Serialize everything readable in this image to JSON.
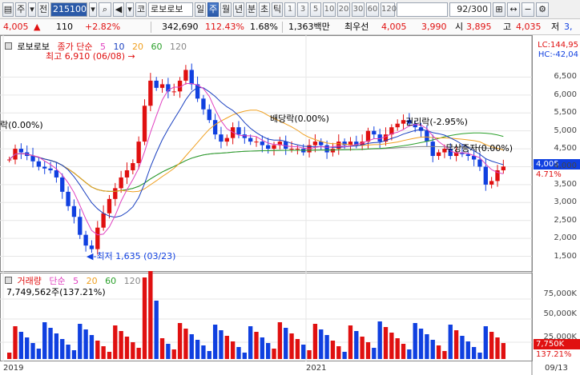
{
  "toolbar": {
    "buttons": [
      {
        "label": "",
        "icon": "chart-window-icon",
        "active": false
      },
      {
        "label": "주",
        "active": false
      },
      {
        "label": "▾",
        "active": false
      },
      {
        "label": "전",
        "active": false
      },
      {
        "label": "215100",
        "active": false
      },
      {
        "label": "▾",
        "active": false
      },
      {
        "label": "",
        "icon": "search-icon",
        "active": false
      },
      {
        "label": "",
        "icon": "speaker-icon",
        "active": false
      },
      {
        "label": "▾",
        "active": false
      },
      {
        "label": "코",
        "active": false
      },
      {
        "label": "로보로보",
        "active": false
      },
      {
        "label": "일",
        "active": false
      },
      {
        "label": "주",
        "active": true
      },
      {
        "label": "월",
        "active": false
      },
      {
        "label": "년",
        "active": false
      },
      {
        "label": "분",
        "active": false
      },
      {
        "label": "초",
        "active": false
      },
      {
        "label": "틱",
        "active": false
      },
      {
        "label": "1",
        "active": false
      },
      {
        "label": "3",
        "active": false
      },
      {
        "label": "5",
        "active": false
      },
      {
        "label": "10",
        "active": false
      },
      {
        "label": "20",
        "active": false
      },
      {
        "label": "30",
        "active": false
      },
      {
        "label": "60",
        "active": false
      },
      {
        "label": "120",
        "active": false
      },
      {
        "label": "",
        "active": false
      },
      {
        "label": "92/300",
        "active": false
      },
      {
        "label": "",
        "icon": "grid-icon",
        "active": false
      },
      {
        "label": "",
        "icon": "arrow-icon",
        "active": false
      },
      {
        "label": "",
        "icon": "minus-icon",
        "active": false
      },
      {
        "label": "",
        "icon": "config-icon",
        "active": false
      }
    ]
  },
  "info": {
    "price": "4,005",
    "change_arrow": "▲",
    "change": "110",
    "change_pct": "+2.82%",
    "volume": "342,690",
    "volume_ratio": "112.43%",
    "turnover": "1.68%",
    "amount": "1,363백만",
    "best_ask_label": "최우선",
    "best_ask": "4,005",
    "best_bid": "3,990",
    "open_label": "시",
    "open": "3,895",
    "high_label": "고",
    "high": "4,035",
    "low_label": "저",
    "low": "3,"
  },
  "legend": {
    "name": "로보로보",
    "ma_label": "종가 단순",
    "periods": [
      "5",
      "10",
      "20",
      "60",
      "120"
    ],
    "vol_label": "거래량",
    "vol_ma_label": "단순",
    "vol_periods": [
      "5",
      "20",
      "60",
      "120"
    ],
    "vol_value": "7,749,562주(137.21%)"
  },
  "corner": {
    "lc": "LC:144,95",
    "hc": "HC:-42,04"
  },
  "annotations": {
    "high": "최고 6,910 (06/08)",
    "low": "최저 1,635 (03/23)",
    "left_event": "락(0.00%)",
    "dividend": "배당락(0.00%)",
    "rights": "권리락(-2.95%)",
    "bonus": "무상증자(0.00%)"
  },
  "badges": {
    "price": "4,005",
    "pct": "4.71%",
    "vol": "7,750K",
    "vol_pct": "137.21%"
  },
  "colors": {
    "up": "#e01010",
    "down": "#1040e0",
    "ma5": "#e040c0",
    "ma10": "#1a40c0",
    "ma20": "#f0a020",
    "ma60": "#2aa02a",
    "ma120": "#888888"
  },
  "chart_data": {
    "type": "candlestick",
    "y_axis": {
      "ticks": [
        "6,500",
        "6,000",
        "5,500",
        "5,000",
        "4,500",
        "4,000",
        "3,500",
        "3,000",
        "2,500",
        "2,000",
        "1,500"
      ],
      "range": [
        1200,
        7000
      ]
    },
    "vol_axis": {
      "ticks": [
        "75,000K",
        "50,000K",
        "25,000K"
      ]
    },
    "x_labels": [
      "2019",
      "2021",
      "09/13"
    ]
  }
}
